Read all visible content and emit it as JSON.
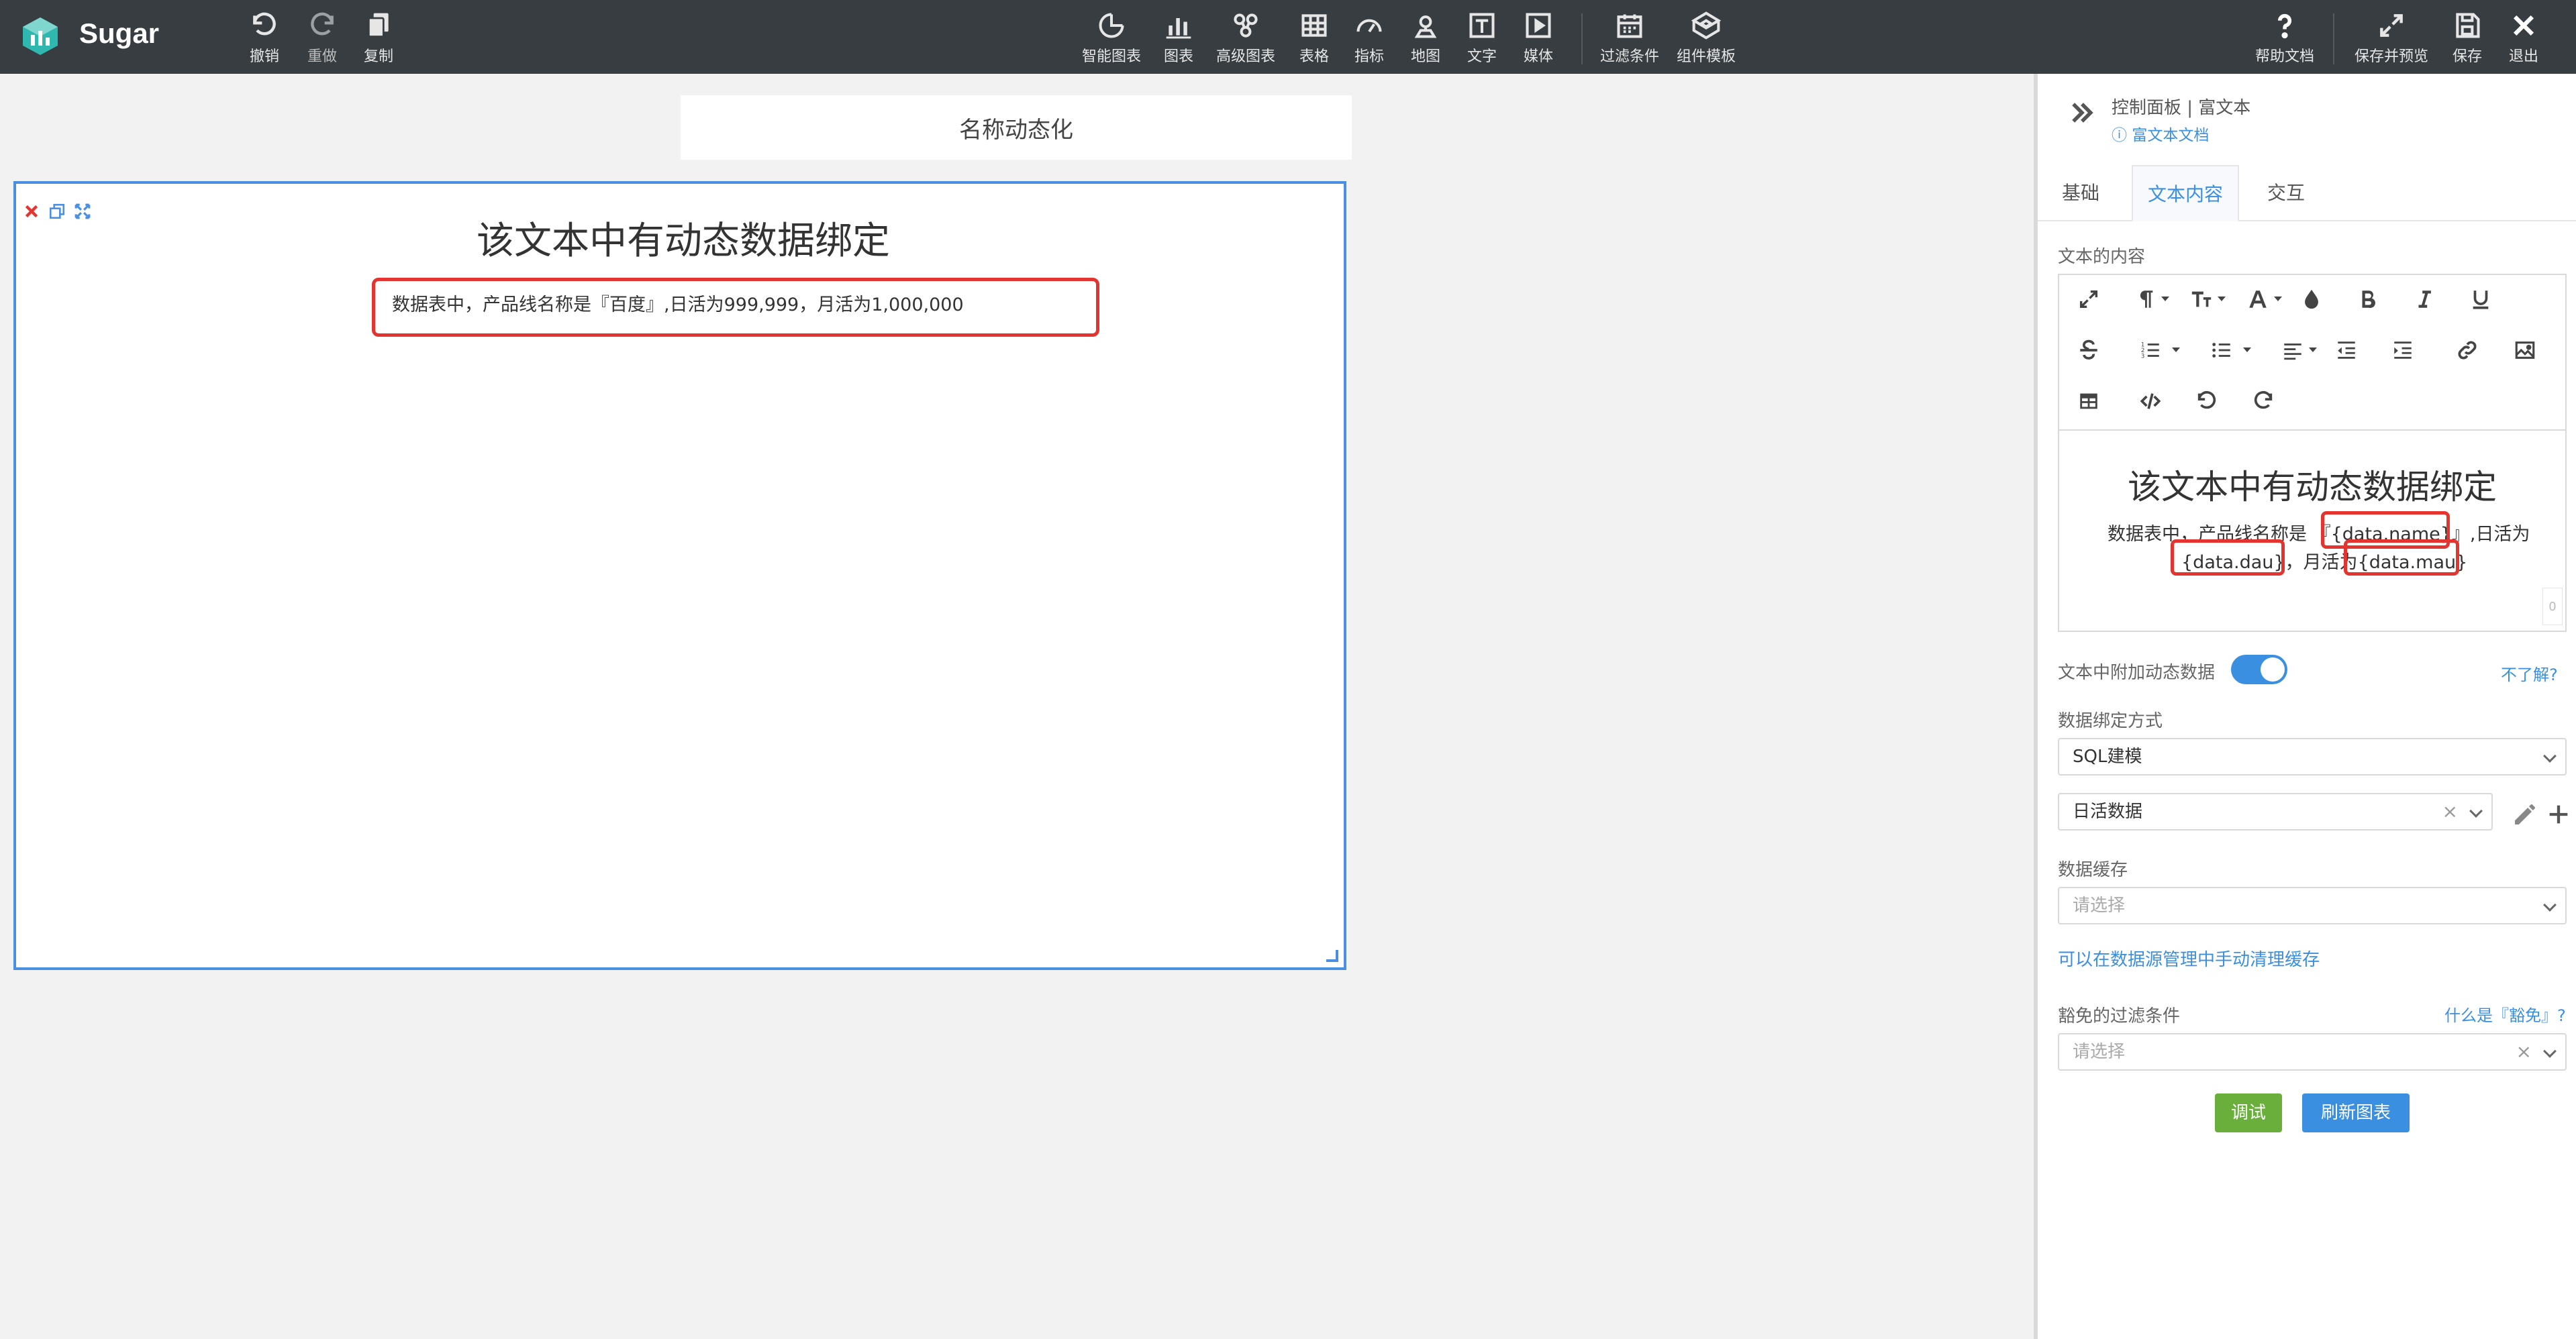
{
  "app": {
    "name": "Sugar"
  },
  "toolbar": {
    "undo": "撤销",
    "redo": "重做",
    "copy": "复制",
    "smart_chart": "智能图表",
    "chart": "图表",
    "advanced_chart": "高级图表",
    "table": "表格",
    "indicator": "指标",
    "map": "地图",
    "text": "文字",
    "media": "媒体",
    "filter": "过滤条件",
    "template": "组件模板",
    "help": "帮助文档",
    "save_preview": "保存并预览",
    "save": "保存",
    "exit": "退出"
  },
  "canvas": {
    "title": "名称动态化",
    "widget": {
      "heading": "该文本中有动态数据绑定",
      "body": "数据表中，产品线名称是『百度』,日活为999,999，月活为1,000,000"
    }
  },
  "panel": {
    "breadcrumb": "控制面板 | 富文本",
    "doc_link": "富文本文档",
    "tabs": [
      "基础",
      "文本内容",
      "交互"
    ],
    "active_tab": "文本内容",
    "content_label": "文本的内容",
    "editor": {
      "heading": "该文本中有动态数据绑定",
      "line1_prefix": "数据表中，产品线名称是",
      "token_name": "『{data.name}』",
      "line1_suffix": ",日活为",
      "token_dau": "{data.dau}",
      "line2_mid": "，月活为",
      "token_mau": "{data.mau}",
      "counter": "0"
    },
    "dynamic_label": "文本中附加动态数据",
    "dynamic_enabled": true,
    "dynamic_help": "不了解?",
    "binding_label": "数据绑定方式",
    "binding_value": "SQL建模",
    "dataset_value": "日活数据",
    "cache_label": "数据缓存",
    "cache_placeholder": "请选择",
    "cache_hint": "可以在数据源管理中手动清理缓存",
    "exempt_label": "豁免的过滤条件",
    "exempt_help": "什么是『豁免』?",
    "exempt_placeholder": "请选择",
    "debug_button": "调试",
    "refresh_button": "刷新图表"
  },
  "colors": {
    "topbar": "#373d41",
    "accent": "#3b8fe0",
    "highlight": "#e3342f",
    "debug": "#6aaf3c"
  }
}
